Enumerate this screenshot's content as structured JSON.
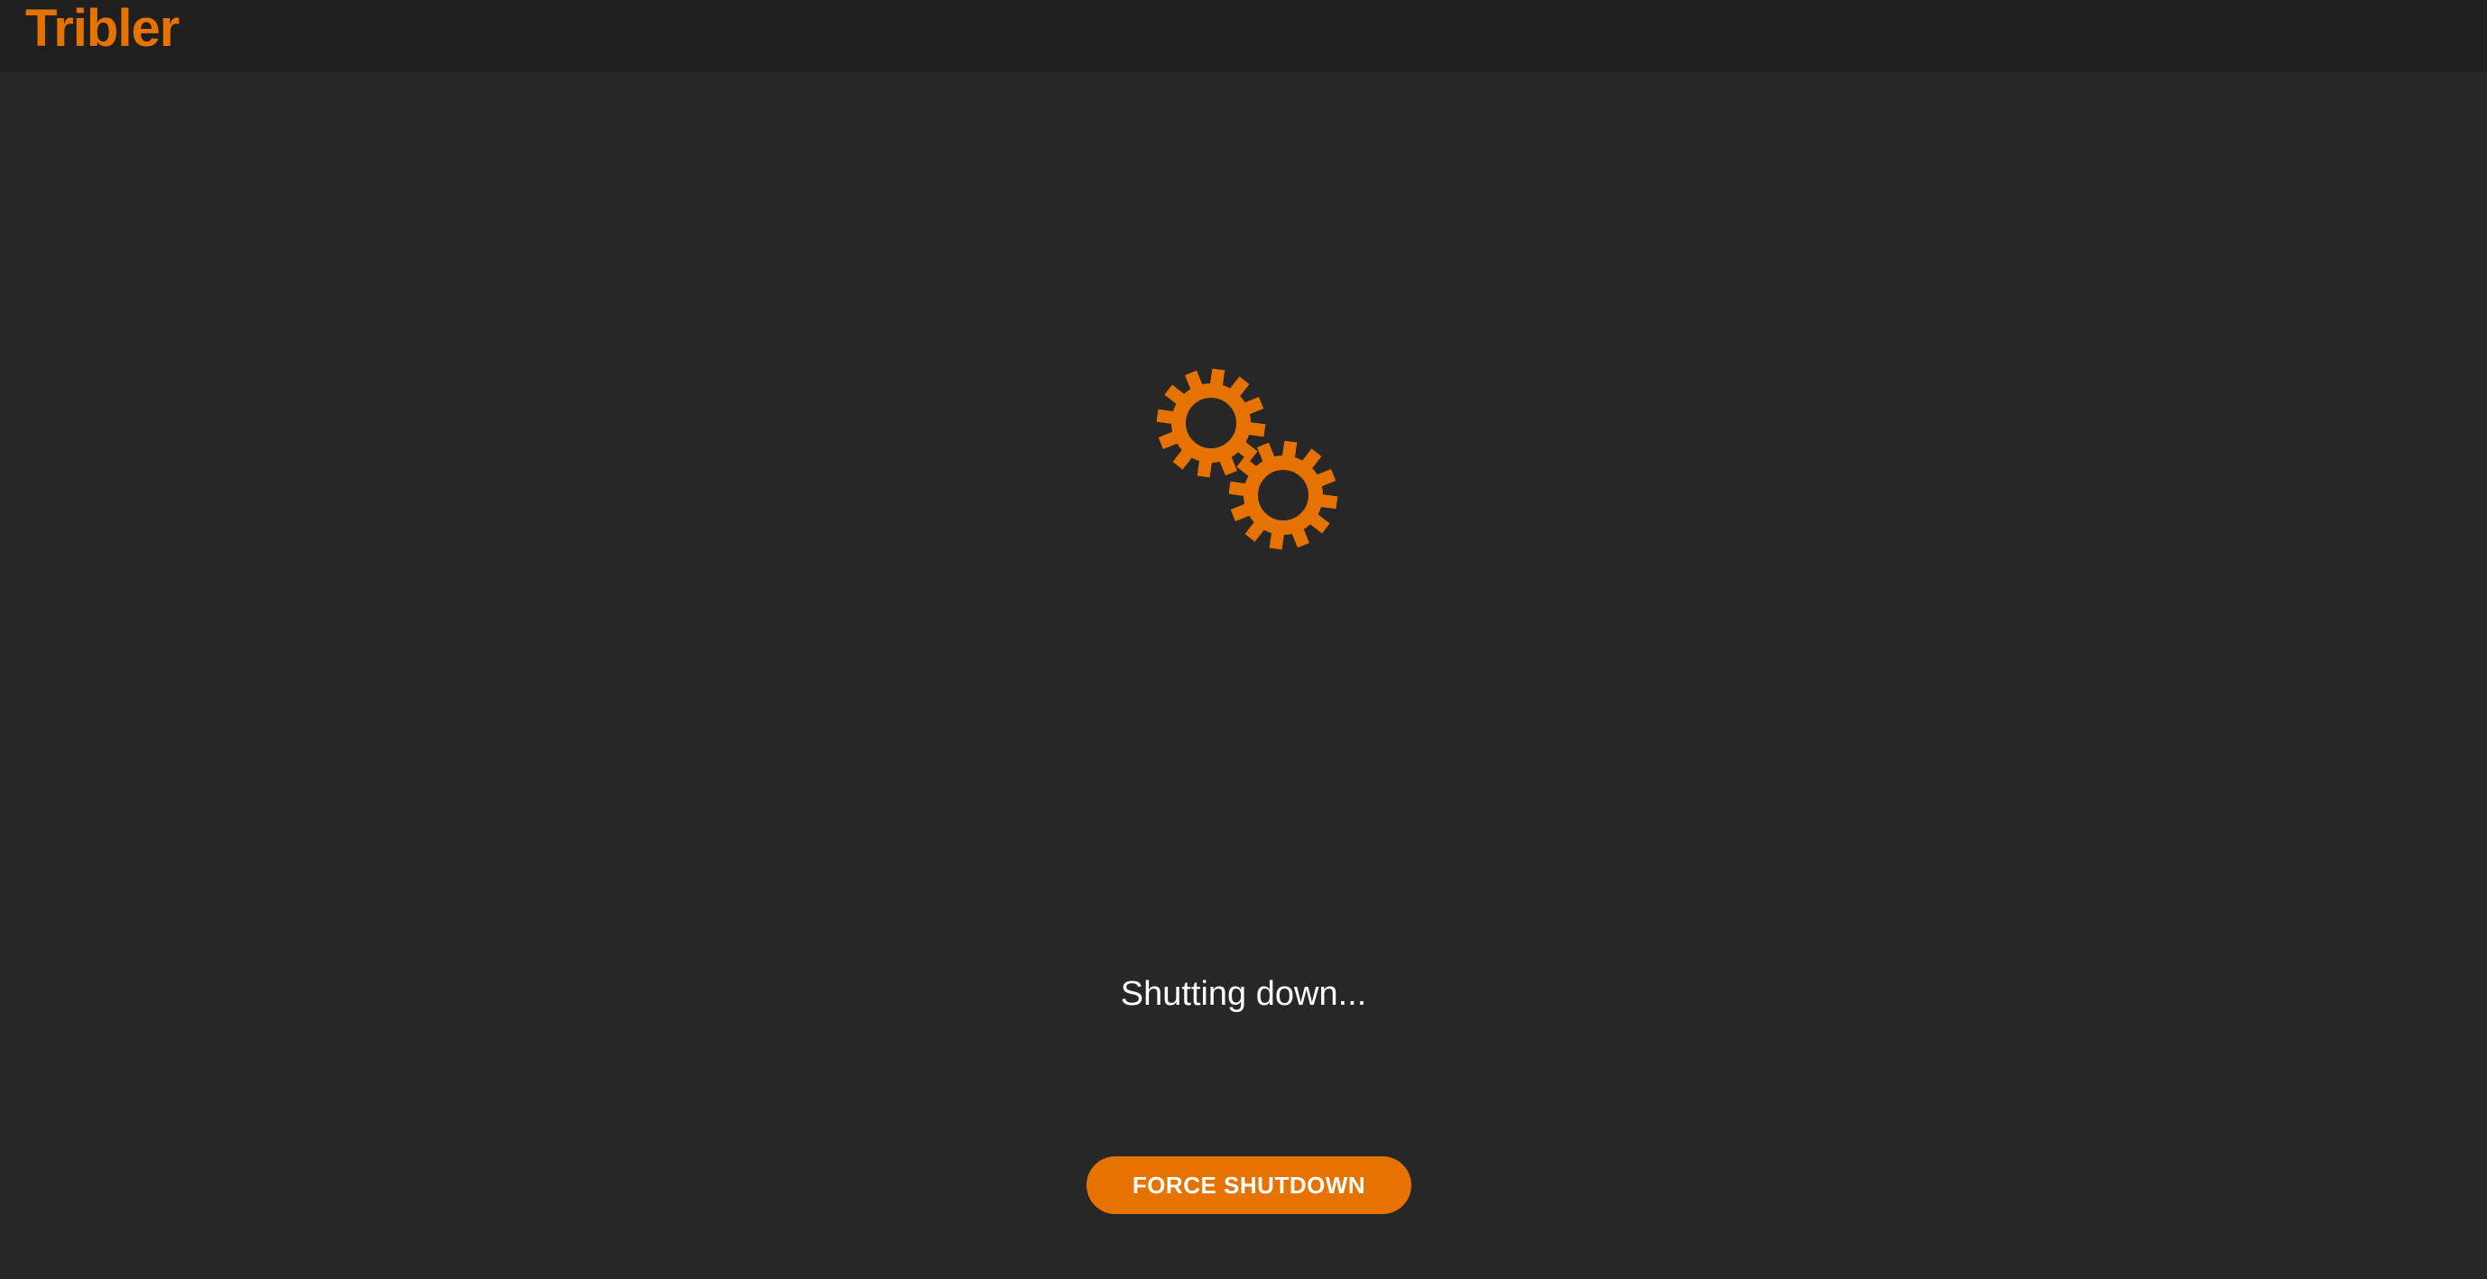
{
  "app": {
    "title": "Tribler",
    "accent_color": "#e67300",
    "background_color": "#272727",
    "header_color": "#1f1f1f"
  },
  "loading": {
    "icon": "gears-icon",
    "status_text": "Shutting down..."
  },
  "actions": {
    "force_shutdown_label": "FORCE SHUTDOWN"
  }
}
